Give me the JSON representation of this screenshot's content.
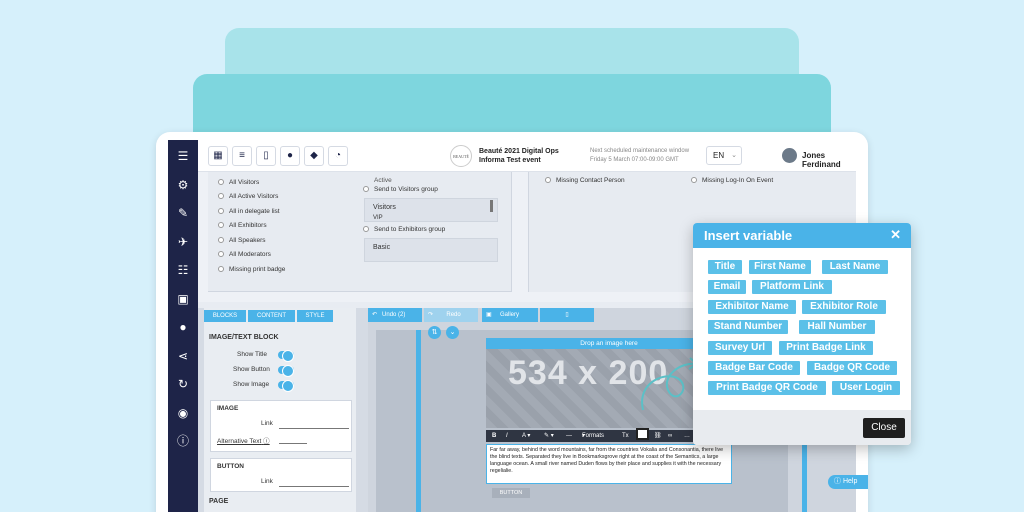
{
  "topbar": {
    "logo_text": "BEAUTÉ",
    "event_line1": "Beauté 2021 Digital Ops",
    "event_line2": "Informa Test event",
    "maintenance_line1": "Next scheduled maintenance window",
    "maintenance_line2": "Friday 5 March 07:00-09:00 GMT",
    "language": "EN",
    "user_name": "Jones Ferdinand"
  },
  "filters": {
    "left_options": [
      "All Visitors",
      "All Active Visitors",
      "All in delegate list",
      "All Exhibitors",
      "All Speakers",
      "All Moderators",
      "Missing print badge"
    ],
    "mid_list_top": "Active",
    "send_visitors": "Send to Visitors group",
    "visitors_box": [
      "Visitors",
      "VIP"
    ],
    "send_exhibitors": "Send to Exhibitors group",
    "basic_box": "Basic",
    "right_options": [
      "Missing Contact Person",
      "Missing Log-In On Event"
    ]
  },
  "editor": {
    "tabs": [
      "BLOCKS",
      "CONTENT",
      "STYLE"
    ],
    "block_title": "IMAGE/TEXT BLOCK",
    "toggles": [
      "Show Title",
      "Show Button",
      "Show Image"
    ],
    "image_section": "IMAGE",
    "image_link_label": "Link",
    "alt_text_label": "Alternative Text",
    "button_section": "BUTTON",
    "button_link_label": "Link",
    "page_section": "PAGE",
    "undo_label": "Undo (2)",
    "redo_label": "Redo",
    "gallery_label": "Gallery",
    "drop_image": "Drop an image here",
    "placeholder_size": "534 x 200",
    "formats_label": "Formats",
    "paragraph": "Far far away, behind the word mountains, far from the countries Vokalia and Consonantia, there live the blind texts. Separated they live in Bookmarksgrove right at the coast of the Semantics, a large language ocean. A small river named Duden flows by their place and supplies it with the necessary regelialie.",
    "button_text": "BUTTON",
    "help_label": "Help"
  },
  "popup": {
    "title": "Insert variable",
    "variables": [
      "Title",
      "First Name",
      "Last Name",
      "Email",
      "Platform Link",
      "Exhibitor Name",
      "Exhibitor Role",
      "Stand Number",
      "Hall Number",
      "Survey Url",
      "Print Badge Link",
      "Badge Bar Code",
      "Badge QR Code",
      "Print Badge QR Code",
      "User Login"
    ],
    "close_label": "Close"
  },
  "colors": {
    "accent": "#4ab3e8",
    "sidebar": "#1e2448",
    "background": "#d6f0fb"
  }
}
